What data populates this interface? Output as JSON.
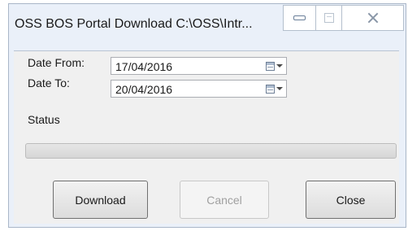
{
  "window": {
    "title": "OSS BOS Portal Download C:\\OSS\\Intr..."
  },
  "form": {
    "date_from_label": "Date From:",
    "date_from_value": "17/04/2016",
    "date_to_label": "Date To:",
    "date_to_value": "20/04/2016",
    "status_label": "Status",
    "progress": 0
  },
  "buttons": {
    "download": "Download",
    "cancel": "Cancel",
    "close": "Close"
  },
  "icons": {
    "minimize": "minimize-icon",
    "maximize": "maximize-icon",
    "close": "close-icon",
    "calendar": "calendar-dropdown-icon"
  }
}
